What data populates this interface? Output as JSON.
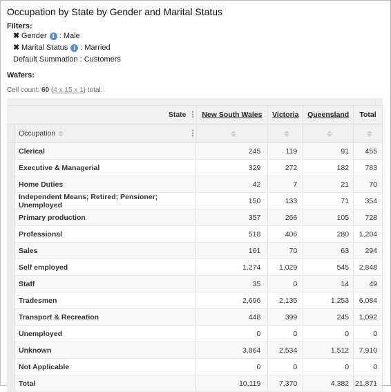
{
  "title": "Occupation by State by Gender and Marital Status",
  "filters": {
    "label": "Filters:",
    "items": [
      {
        "name": "Gender",
        "value": ": Male"
      },
      {
        "name": "Marital Status",
        "value": ": Married"
      }
    ],
    "default_summation": "Default Summation : Customers"
  },
  "wafers_label": "Wafers:",
  "cell_count": {
    "prefix": "Cell count: ",
    "count": "60",
    "open": " (",
    "dims": "4 x 15 x 1",
    "suffix": ") total."
  },
  "table": {
    "column_dimension": "State",
    "row_dimension": "Occupation",
    "columns": [
      "New South Wales",
      "Victoria",
      "Queensland",
      "Total"
    ],
    "rows": [
      {
        "label": "Clerical",
        "values": [
          "245",
          "119",
          "91",
          "455"
        ]
      },
      {
        "label": "Executive & Managerial",
        "values": [
          "329",
          "272",
          "182",
          "783"
        ]
      },
      {
        "label": "Home Duties",
        "values": [
          "42",
          "7",
          "21",
          "70"
        ]
      },
      {
        "label": "Independent Means; Retired; Pensioner; Unemployed",
        "values": [
          "150",
          "133",
          "71",
          "354"
        ]
      },
      {
        "label": "Primary production",
        "values": [
          "357",
          "266",
          "105",
          "728"
        ]
      },
      {
        "label": "Professional",
        "values": [
          "518",
          "406",
          "280",
          "1,204"
        ]
      },
      {
        "label": "Sales",
        "values": [
          "161",
          "70",
          "63",
          "294"
        ]
      },
      {
        "label": "Self employed",
        "values": [
          "1,274",
          "1,029",
          "545",
          "2,848"
        ]
      },
      {
        "label": "Staff",
        "values": [
          "35",
          "0",
          "14",
          "49"
        ]
      },
      {
        "label": "Tradesmen",
        "values": [
          "2,696",
          "2,135",
          "1,253",
          "6,084"
        ]
      },
      {
        "label": "Transport & Recreation",
        "values": [
          "448",
          "399",
          "245",
          "1,092"
        ]
      },
      {
        "label": "Unemployed",
        "values": [
          "0",
          "0",
          "0",
          "0"
        ]
      },
      {
        "label": "Unknown",
        "values": [
          "3,864",
          "2,534",
          "1,512",
          "7,910"
        ]
      },
      {
        "label": "Not Applicable",
        "values": [
          "0",
          "0",
          "0",
          "0"
        ]
      },
      {
        "label": "Total",
        "values": [
          "10,119",
          "7,370",
          "4,382",
          "21,871"
        ]
      }
    ]
  }
}
